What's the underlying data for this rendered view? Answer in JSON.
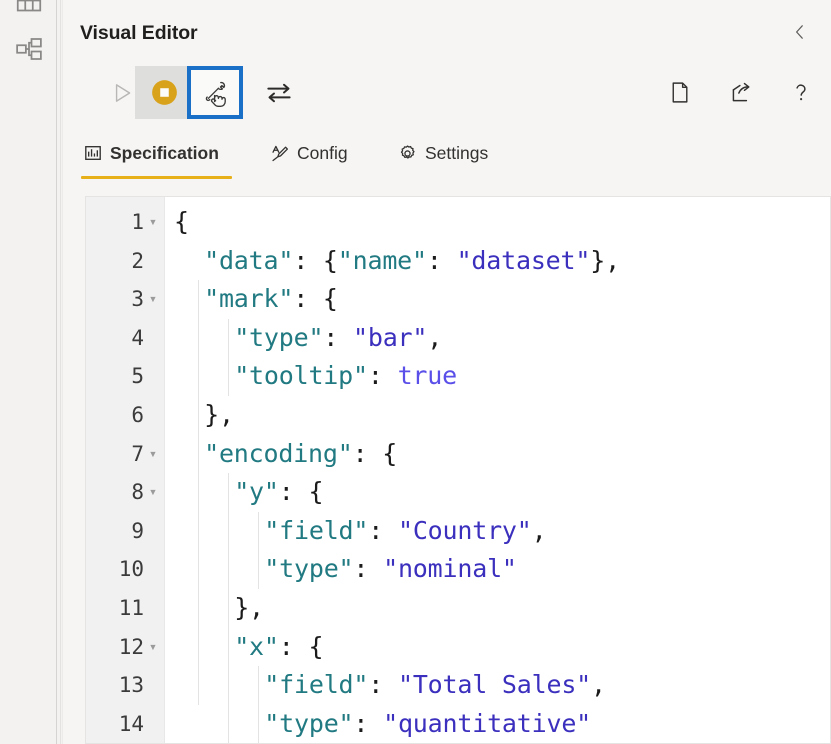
{
  "left_rail": {
    "items": [
      {
        "name": "table-view-icon",
        "label": "Table view"
      },
      {
        "name": "model-view-icon",
        "label": "Model view"
      }
    ]
  },
  "panel": {
    "title": "Visual Editor",
    "collapse_icon": "chevron-left-icon"
  },
  "toolbar": {
    "left_buttons": [
      {
        "name": "run-button",
        "icon": "play-icon",
        "label": "Run",
        "state": "disabled"
      },
      {
        "name": "stop-button",
        "icon": "stop-icon",
        "label": "Stop",
        "state": "active"
      },
      {
        "name": "edit-button",
        "icon": "edit-pick-icon",
        "label": "Edit",
        "state": "selected"
      },
      {
        "name": "swap-button",
        "icon": "swap-arrows-icon",
        "label": "Swap axes",
        "state": "default"
      }
    ],
    "right_buttons": [
      {
        "name": "new-specification-button",
        "icon": "page-icon",
        "label": "New specification"
      },
      {
        "name": "export-button",
        "icon": "share-icon",
        "label": "Export"
      },
      {
        "name": "help-button",
        "icon": "help-icon",
        "label": "Help"
      }
    ],
    "selection_color": "#1a70c7",
    "stop_color": "#d9a21b"
  },
  "tabs": {
    "active": "Specification",
    "accent_color": "#e8b018",
    "items": [
      {
        "name": "tab-specification",
        "label": "Specification",
        "icon": "bar-chart-icon"
      },
      {
        "name": "tab-config",
        "label": "Config",
        "icon": "pen-icon"
      },
      {
        "name": "tab-settings",
        "label": "Settings",
        "icon": "gear-icon"
      }
    ]
  },
  "editor": {
    "language": "json",
    "colors": {
      "key": "#217a82",
      "string": "#3b2fbe",
      "boolean": "#5a4fe8",
      "punctuation": "#1b1b1b",
      "gutter_background": "#f1f1f1",
      "background": "#ffffff"
    },
    "lines": [
      {
        "n": "1",
        "fold": true,
        "indent": 0,
        "tokens": [
          {
            "t": "{",
            "c": "p"
          }
        ]
      },
      {
        "n": "2",
        "fold": false,
        "indent": 1,
        "tokens": [
          {
            "t": "\"data\"",
            "c": "k"
          },
          {
            "t": ": {",
            "c": "p"
          },
          {
            "t": "\"name\"",
            "c": "k"
          },
          {
            "t": ": ",
            "c": "p"
          },
          {
            "t": "\"dataset\"",
            "c": "s"
          },
          {
            "t": "},",
            "c": "p"
          }
        ]
      },
      {
        "n": "3",
        "fold": true,
        "indent": 1,
        "tokens": [
          {
            "t": "\"mark\"",
            "c": "k"
          },
          {
            "t": ": {",
            "c": "p"
          }
        ]
      },
      {
        "n": "4",
        "fold": false,
        "indent": 2,
        "tokens": [
          {
            "t": "\"type\"",
            "c": "k"
          },
          {
            "t": ": ",
            "c": "p"
          },
          {
            "t": "\"bar\"",
            "c": "s"
          },
          {
            "t": ",",
            "c": "p"
          }
        ]
      },
      {
        "n": "5",
        "fold": false,
        "indent": 2,
        "tokens": [
          {
            "t": "\"tooltip\"",
            "c": "k"
          },
          {
            "t": ": ",
            "c": "p"
          },
          {
            "t": "true",
            "c": "b"
          }
        ]
      },
      {
        "n": "6",
        "fold": false,
        "indent": 1,
        "tokens": [
          {
            "t": "},",
            "c": "p"
          }
        ]
      },
      {
        "n": "7",
        "fold": true,
        "indent": 1,
        "tokens": [
          {
            "t": "\"encoding\"",
            "c": "k"
          },
          {
            "t": ": {",
            "c": "p"
          }
        ]
      },
      {
        "n": "8",
        "fold": true,
        "indent": 2,
        "tokens": [
          {
            "t": "\"y\"",
            "c": "k"
          },
          {
            "t": ": {",
            "c": "p"
          }
        ]
      },
      {
        "n": "9",
        "fold": false,
        "indent": 3,
        "tokens": [
          {
            "t": "\"field\"",
            "c": "k"
          },
          {
            "t": ": ",
            "c": "p"
          },
          {
            "t": "\"Country\"",
            "c": "s"
          },
          {
            "t": ",",
            "c": "p"
          }
        ]
      },
      {
        "n": "10",
        "fold": false,
        "indent": 3,
        "tokens": [
          {
            "t": "\"type\"",
            "c": "k"
          },
          {
            "t": ": ",
            "c": "p"
          },
          {
            "t": "\"nominal\"",
            "c": "s"
          }
        ]
      },
      {
        "n": "11",
        "fold": false,
        "indent": 2,
        "tokens": [
          {
            "t": "},",
            "c": "p"
          }
        ]
      },
      {
        "n": "12",
        "fold": true,
        "indent": 2,
        "tokens": [
          {
            "t": "\"x\"",
            "c": "k"
          },
          {
            "t": ": {",
            "c": "p"
          }
        ]
      },
      {
        "n": "13",
        "fold": false,
        "indent": 3,
        "tokens": [
          {
            "t": "\"field\"",
            "c": "k"
          },
          {
            "t": ": ",
            "c": "p"
          },
          {
            "t": "\"Total Sales\"",
            "c": "s"
          },
          {
            "t": ",",
            "c": "p"
          }
        ]
      },
      {
        "n": "14",
        "fold": false,
        "indent": 3,
        "tokens": [
          {
            "t": "\"type\"",
            "c": "k"
          },
          {
            "t": ": ",
            "c": "p"
          },
          {
            "t": "\"quantitative\"",
            "c": "s"
          }
        ]
      }
    ]
  }
}
